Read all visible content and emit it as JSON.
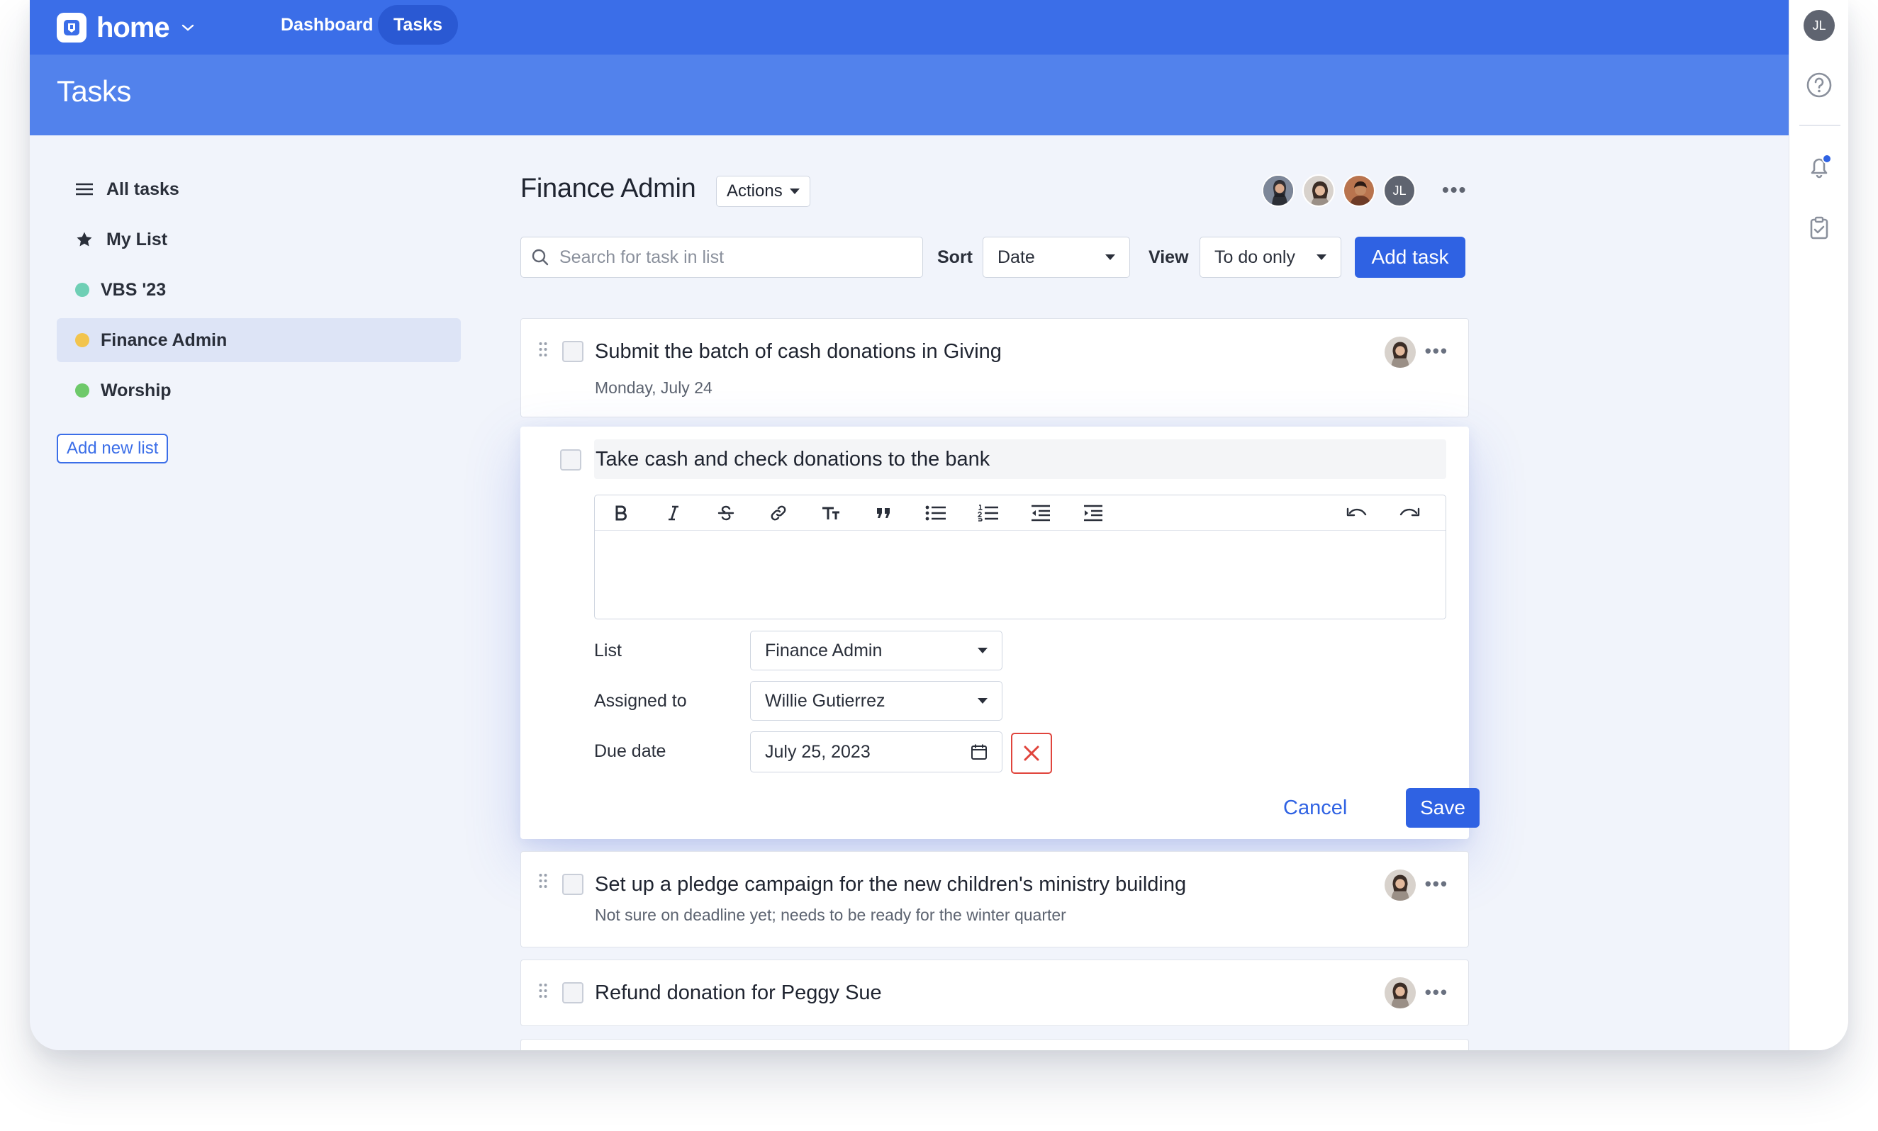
{
  "app": {
    "brand": "home",
    "nav": [
      "Dashboard",
      "Tasks"
    ],
    "page_title": "Tasks",
    "user_initials": "JL"
  },
  "sidebar": {
    "items": [
      {
        "label": "All tasks",
        "icon": "list-icon"
      },
      {
        "label": "My List",
        "icon": "star-icon"
      },
      {
        "label": "VBS '23",
        "color": "#6fcfb5"
      },
      {
        "label": "Finance Admin",
        "color": "#f2c44d",
        "selected": true
      },
      {
        "label": "Worship",
        "color": "#6ec96a"
      }
    ],
    "add_list": "Add new list"
  },
  "list": {
    "title": "Finance Admin",
    "actions": "Actions",
    "member_initials": "JL",
    "search_placeholder": "Search for task in list",
    "sort_label": "Sort",
    "sort_value": "Date",
    "view_label": "View",
    "view_value": "To do only",
    "add_task": "Add task"
  },
  "tasks": [
    {
      "title": "Submit the batch of cash donations in Giving",
      "subtitle": "Monday, July 24"
    },
    {
      "title": "Set up a pledge campaign for the new children's ministry building",
      "subtitle": "Not sure on deadline yet; needs to be ready for the winter quarter"
    },
    {
      "title": "Refund donation for Peggy Sue",
      "subtitle": ""
    }
  ],
  "editor": {
    "title": "Take cash and check donations to the bank",
    "list_label": "List",
    "list_value": "Finance Admin",
    "assigned_label": "Assigned to",
    "assigned_value": "Willie Gutierrez",
    "due_label": "Due date",
    "due_value": "July 25, 2023",
    "cancel": "Cancel",
    "save": "Save"
  },
  "colors": {
    "primary": "#3b6ee8",
    "danger": "#e0443c"
  }
}
